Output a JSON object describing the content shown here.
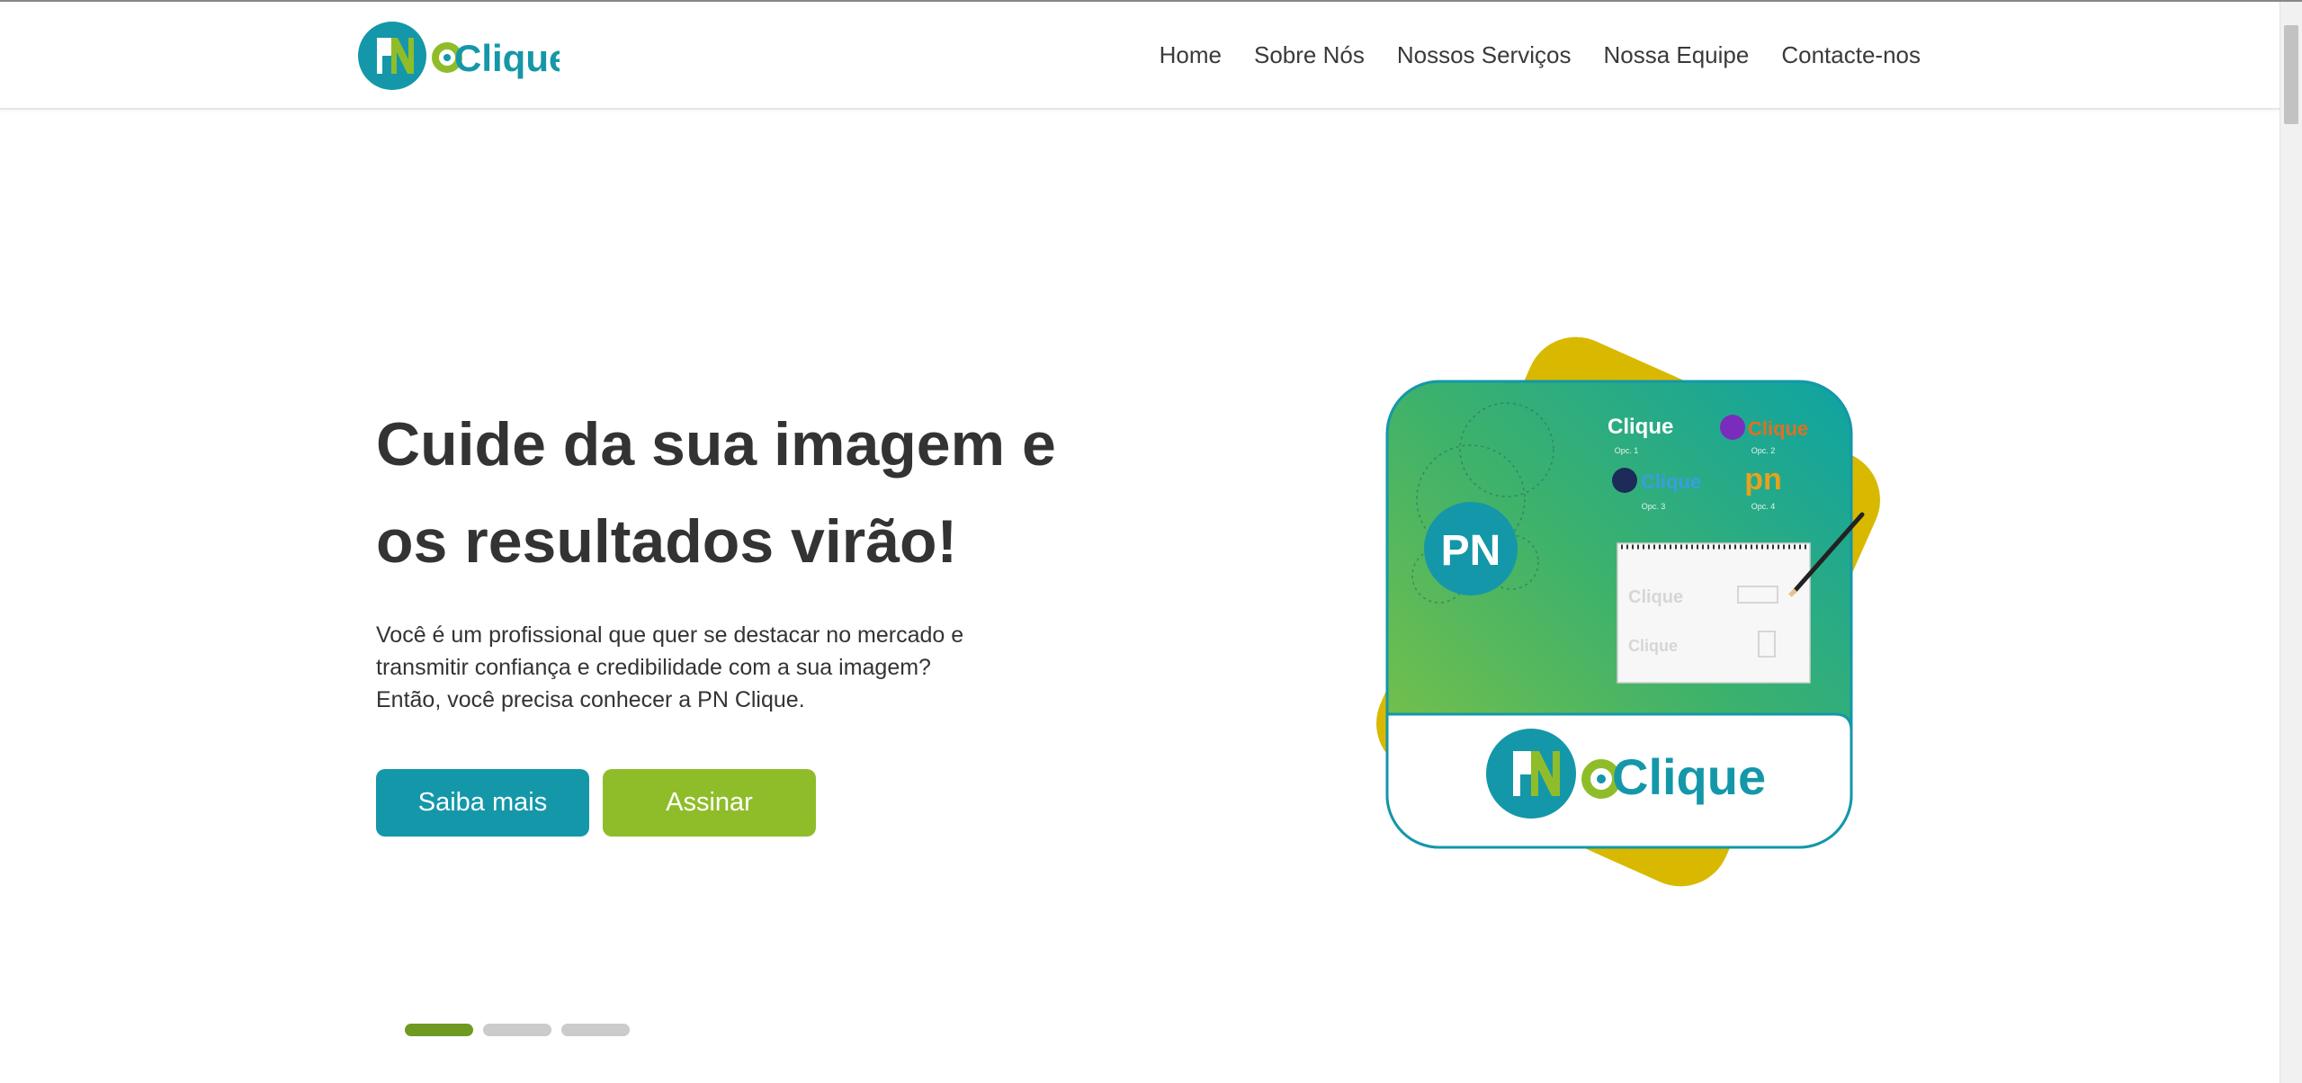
{
  "header": {
    "logo_text": "Clique",
    "logo_monogram": "PN",
    "nav": [
      "Home",
      "Sobre Nós",
      "Nossos Serviços",
      "Nossa Equipe",
      "Contacte-nos"
    ]
  },
  "hero": {
    "title_lines": [
      "Cuide da sua imagem e",
      "os resultados virão!"
    ],
    "text_lines": [
      "Você é um profissional que quer se destacar no mercado e",
      "transmitir confiança e credibilidade com a sua imagem?",
      "Então, você precisa conhecer a PN Clique."
    ],
    "button_primary": "Saiba mais",
    "button_secondary": "Assinar"
  },
  "illustration": {
    "options": [
      "Opc. 1",
      "Opc. 2",
      "Opc. 3",
      "Opc. 4"
    ],
    "brand_text": "Clique",
    "monogram": "PN",
    "alt_mark": "pn"
  },
  "carousel": {
    "slides": 3,
    "active": 1
  },
  "colors": {
    "teal": "#1497a9",
    "green": "#8fbd2a",
    "yellow": "#d9b900",
    "dot_active": "#6f9a22",
    "dot_inactive": "#cbcbcb"
  }
}
